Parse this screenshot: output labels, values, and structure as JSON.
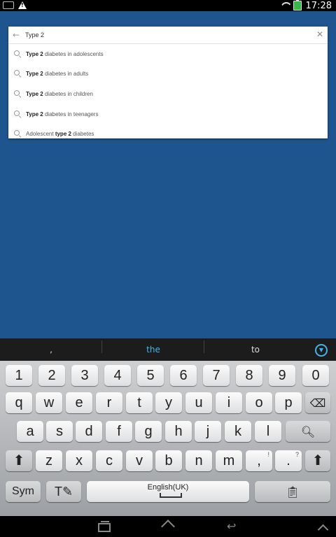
{
  "status_bar": {
    "time": "17:28",
    "icons": [
      "keyboard-icon",
      "warning-icon",
      "wifi-icon",
      "battery-icon"
    ]
  },
  "search": {
    "query": "Type 2",
    "suggestions": [
      {
        "bold": "Type 2",
        "rest": " diabetes in adolescents",
        "prefix": ""
      },
      {
        "bold": "Type 2",
        "rest": " diabetes in adults",
        "prefix": ""
      },
      {
        "bold": "Type 2",
        "rest": " diabetes in children",
        "prefix": ""
      },
      {
        "bold": "Type 2",
        "rest": " diabetes in teenagers",
        "prefix": ""
      },
      {
        "prefix": "Adolescent ",
        "bold": "type 2",
        "rest": " diabetes"
      }
    ]
  },
  "prediction_bar": {
    "left": ",",
    "center": "the",
    "right": "to"
  },
  "keyboard": {
    "row_numbers": [
      "1",
      "2",
      "3",
      "4",
      "5",
      "6",
      "7",
      "8",
      "9",
      "0"
    ],
    "row_q": [
      "q",
      "w",
      "e",
      "r",
      "t",
      "y",
      "u",
      "i",
      "o",
      "p"
    ],
    "row_a": [
      "a",
      "s",
      "d",
      "f",
      "g",
      "h",
      "j",
      "k",
      "l"
    ],
    "row_z": [
      "z",
      "x",
      "c",
      "v",
      "b",
      "n",
      "m"
    ],
    "comma_key": ",",
    "comma_alt": "!",
    "period_key": ".",
    "period_alt": "?",
    "sym_label": "Sym",
    "space_label": "English(UK)"
  },
  "colors": {
    "background": "#1f558e",
    "accent": "#43b5e9"
  }
}
